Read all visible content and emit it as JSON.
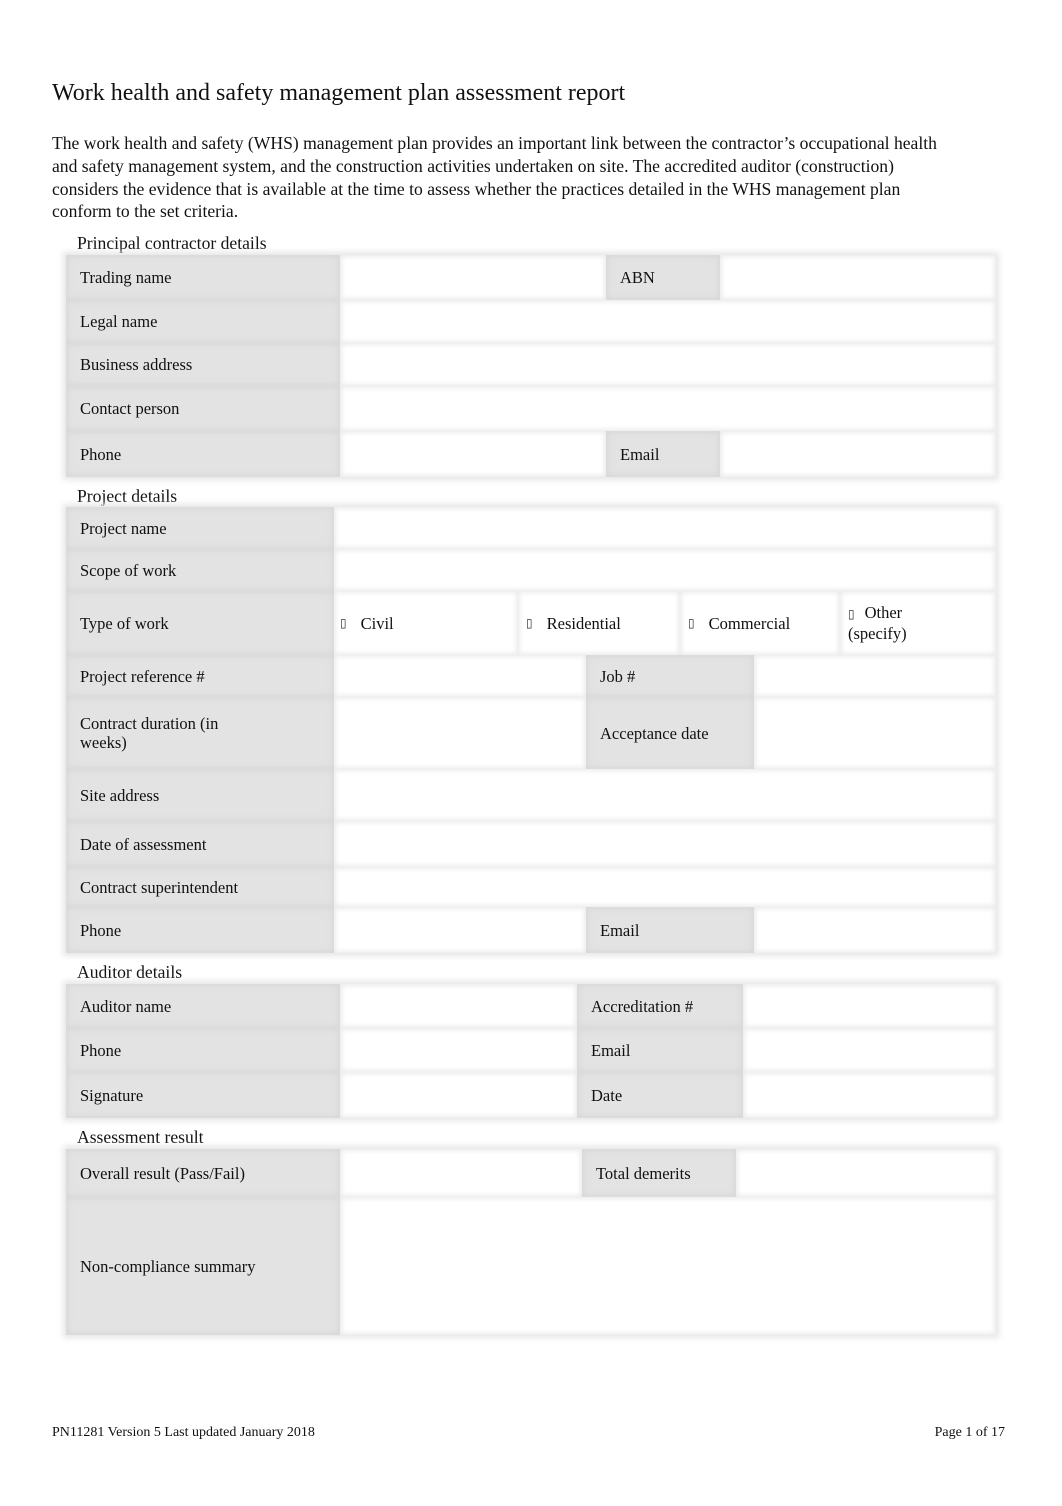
{
  "document": {
    "title": "Work health and safety management plan assessment report",
    "intro": "The work health and safety (WHS) management plan provides an important link between the contractor’s occupational health and safety management system, and the construction activities undertaken on site. The accredited auditor (construction) considers the evidence that is available at the time to assess whether the practices detailed in the WHS management plan conform to the set criteria."
  },
  "principal_contractor": {
    "heading": "Principal contractor details",
    "trading_name": "Trading name",
    "abn": "ABN",
    "legal_name": "Legal name",
    "business_address": "Business address",
    "contact_person": "Contact person",
    "phone": "Phone",
    "email": "Email"
  },
  "project": {
    "heading": "Project details",
    "project_name": "Project name",
    "scope_of_work": "Scope of work",
    "type_of_work": "Type of work",
    "type_options": [
      {
        "label": "Civil",
        "checked": false
      },
      {
        "label": "Residential",
        "checked": false
      },
      {
        "label": "Commercial",
        "checked": false
      },
      {
        "label": "Other (specify)",
        "checked": false
      }
    ],
    "checkbox_glyph": "▯",
    "project_reference": "Project reference #",
    "job_number": "Job #",
    "contract_duration": "Contract duration (in weeks)",
    "acceptance_date": "Acceptance date",
    "site_address": "Site address",
    "date_of_assessment": "Date of assessment",
    "contract_superintendent": "Contract superintendent",
    "phone": "Phone",
    "email": "Email"
  },
  "auditor": {
    "heading": "Auditor details",
    "auditor_name": "Auditor name",
    "accreditation": "Accreditation #",
    "phone": "Phone",
    "email": "Email",
    "signature": "Signature",
    "date": "Date"
  },
  "assessment": {
    "heading": "Assessment result",
    "overall_result": "Overall result (Pass/Fail)",
    "total_demerits": "Total demerits",
    "non_compliance_summary": "Non-compliance summary"
  },
  "footer": {
    "left": "PN11281 Version 5 Last updated January 2018",
    "right": "Page 1 of 17"
  }
}
